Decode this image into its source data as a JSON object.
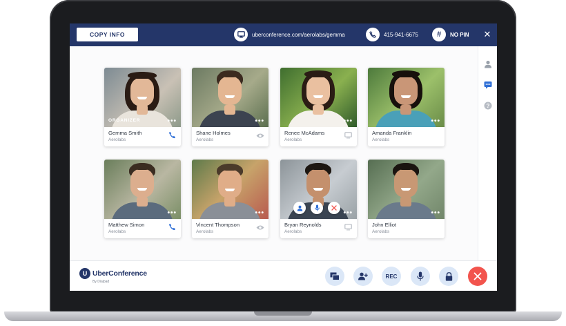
{
  "header": {
    "copy_info_label": "COPY INFO",
    "conference_url": "uberconference.com/aerolabs/gemma",
    "phone_number": "415-941-6675",
    "pin_label": "NO PIN",
    "pin_symbol": "#",
    "close_symbol": "✕"
  },
  "participants": [
    {
      "name": "Gemma Smith",
      "company": "Aerolabs",
      "tag": "ORGANIZER",
      "status": "phone"
    },
    {
      "name": "Shane Holmes",
      "company": "Aerolabs",
      "tag": "",
      "status": "eye"
    },
    {
      "name": "Renee McAdams",
      "company": "Aerolabs",
      "tag": "",
      "status": "screen"
    },
    {
      "name": "Amanda Franklin",
      "company": "Aerolabs",
      "tag": "",
      "status": ""
    },
    {
      "name": "Matthew Simon",
      "company": "Aerolabs",
      "tag": "",
      "status": "phone"
    },
    {
      "name": "Vincent Thompson",
      "company": "Aerolabs",
      "tag": "",
      "status": "eye"
    },
    {
      "name": "Bryan Reynolds",
      "company": "Aerolabs",
      "tag": "",
      "status": "screen"
    },
    {
      "name": "John Elliot",
      "company": "Aerolabs",
      "tag": "",
      "status": ""
    }
  ],
  "more_symbol": "•••",
  "footer": {
    "brand_name": "UberConference",
    "brand_sub": "By Dialpad",
    "brand_mark": "U",
    "rec_label": "REC"
  },
  "colors": {
    "header_bg": "#243669",
    "accent_blue": "#2f6fd6",
    "end_call_red": "#f2544d",
    "button_bg": "#dbe7f7"
  }
}
